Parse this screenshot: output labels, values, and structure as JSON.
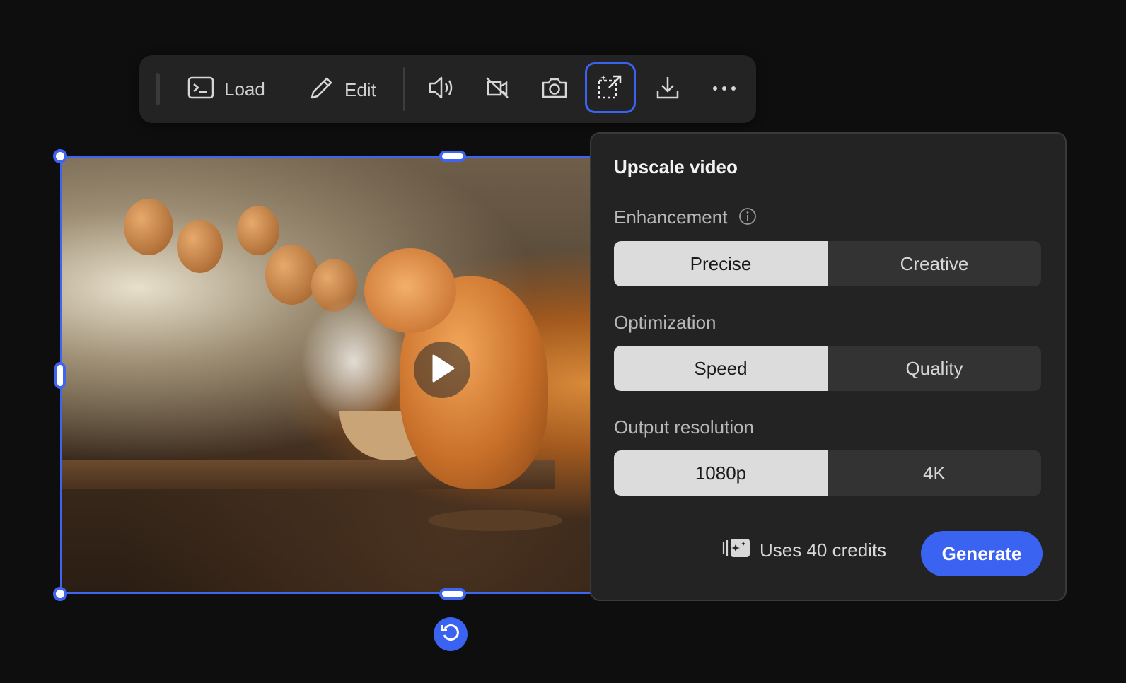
{
  "toolbar": {
    "load_label": "Load",
    "edit_label": "Edit",
    "icons": [
      "terminal-icon",
      "pencil-icon",
      "speaker-icon",
      "camera-off-icon",
      "camera-icon",
      "upscale-icon",
      "download-icon",
      "more-icon"
    ]
  },
  "panel": {
    "title": "Upscale video",
    "enhancement": {
      "label": "Enhancement",
      "options": [
        "Precise",
        "Creative"
      ],
      "selected": "Precise"
    },
    "optimization": {
      "label": "Optimization",
      "options": [
        "Speed",
        "Quality"
      ],
      "selected": "Speed"
    },
    "resolution": {
      "label": "Output resolution",
      "options": [
        "1080p",
        "4K"
      ],
      "selected": "1080p"
    },
    "credits_text": "Uses 40 credits",
    "generate_label": "Generate"
  },
  "colors": {
    "accent": "#3b63f2",
    "panel_bg": "#232324",
    "page_bg": "#0e0e0f"
  }
}
